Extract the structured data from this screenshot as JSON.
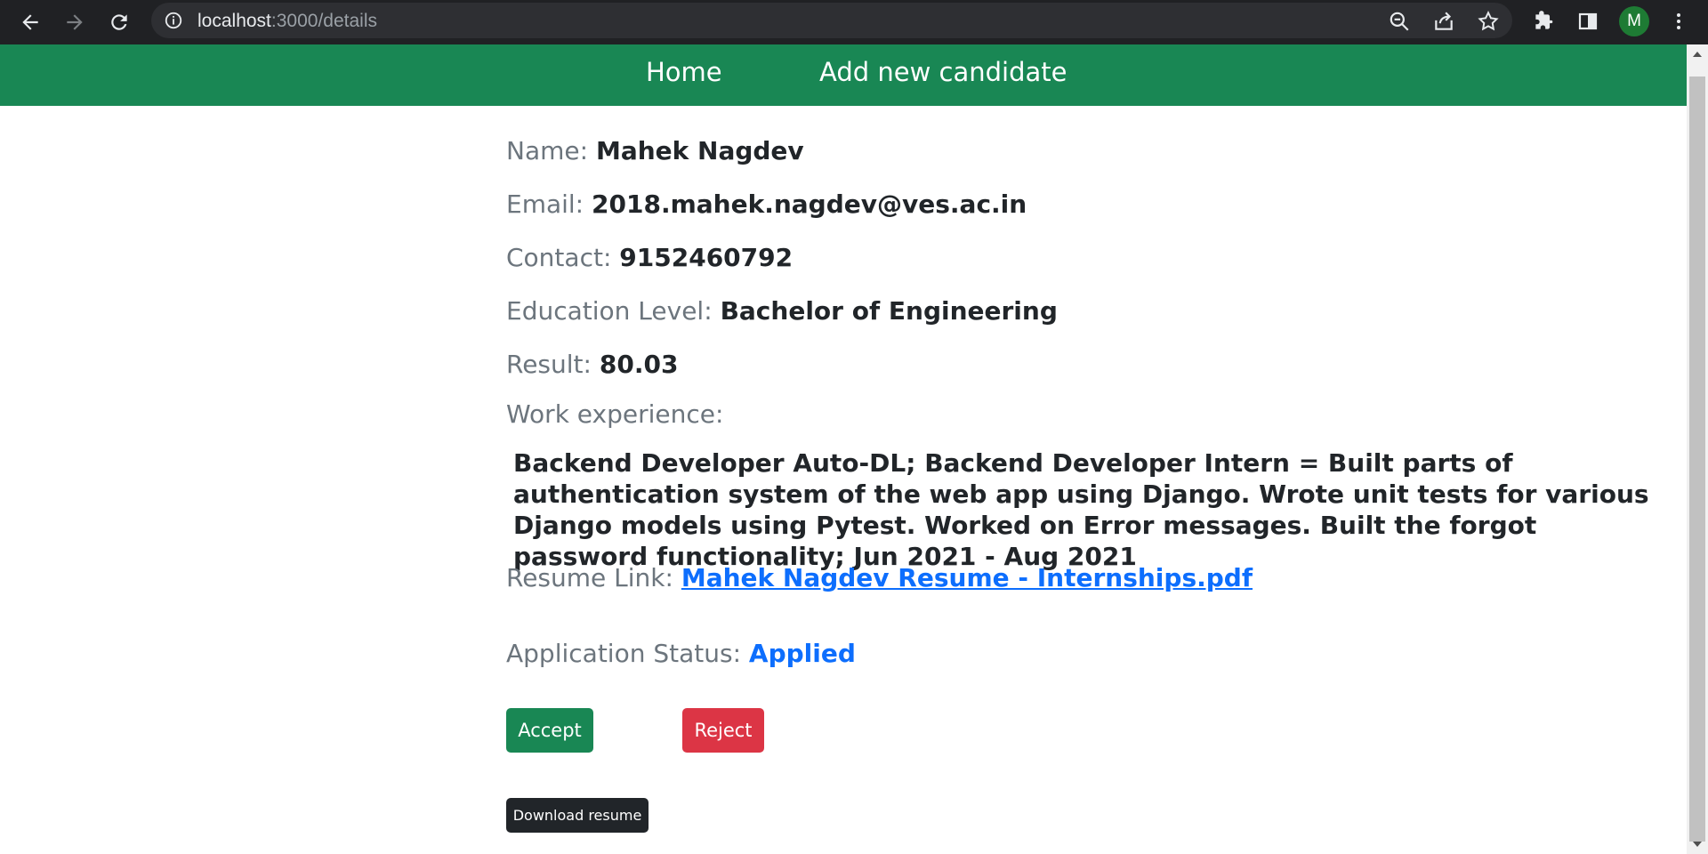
{
  "browser": {
    "url_host": "localhost",
    "url_path": ":3000/details",
    "profile_initial": "M"
  },
  "navbar": {
    "home_label": "Home",
    "add_label": "Add new candidate"
  },
  "candidate": {
    "name_label": "Name:",
    "name_value": "Mahek Nagdev",
    "email_label": "Email:",
    "email_value": "2018.mahek.nagdev@ves.ac.in",
    "contact_label": "Contact:",
    "contact_value": "9152460792",
    "education_label": "Education Level:",
    "education_value": "Bachelor of Engineering",
    "result_label": "Result:",
    "result_value": "80.03",
    "work_label": "Work experience:",
    "work_value": "Backend Developer Auto-DL; Backend Developer Intern = Built parts of authentication system of the web app using Django. Wrote unit tests for various Django models using Pytest. Worked on Error messages. Built the forgot password functionality; Jun 2021 - Aug 2021",
    "resume_label": "Resume Link:",
    "resume_link_text": "Mahek Nagdev Resume - Internships.pdf",
    "status_label": "Application Status:",
    "status_value": "Applied"
  },
  "actions": {
    "accept_label": "Accept",
    "reject_label": "Reject",
    "download_label": "Download resume"
  },
  "colors": {
    "navbar": "#198754",
    "accept": "#198754",
    "reject": "#dc3545",
    "download": "#212529",
    "link": "#0d6efd"
  }
}
